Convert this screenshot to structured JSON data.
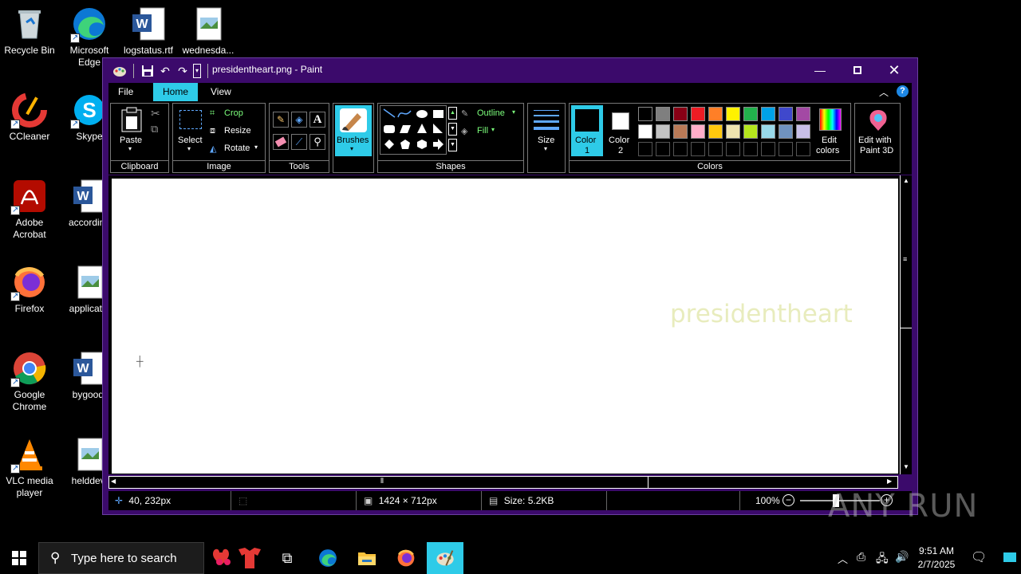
{
  "desktop": {
    "icons": [
      {
        "label": "Recycle Bin"
      },
      {
        "label": "Microsoft Edge"
      },
      {
        "label": "logstatus.rtf"
      },
      {
        "label": "wednesda..."
      },
      {
        "label": "CCleaner"
      },
      {
        "label": "Skype"
      },
      {
        "label": "Adobe Acrobat"
      },
      {
        "label": "according"
      },
      {
        "label": "Firefox"
      },
      {
        "label": "applicatio"
      },
      {
        "label": "Google Chrome"
      },
      {
        "label": "bygood."
      },
      {
        "label": "VLC media player"
      },
      {
        "label": "helddevi"
      }
    ]
  },
  "paint": {
    "title": "presidentheart.png - Paint",
    "tabs": [
      "File",
      "Home",
      "View"
    ],
    "active_tab": "Home",
    "ribbon": {
      "clipboard": {
        "label": "Clipboard",
        "paste": "Paste"
      },
      "image": {
        "label": "Image",
        "select": "Select",
        "crop": "Crop",
        "resize": "Resize",
        "rotate": "Rotate"
      },
      "tools": {
        "label": "Tools"
      },
      "brushes": {
        "label": "Brushes"
      },
      "shapes": {
        "label": "Shapes",
        "outline": "Outline",
        "fill": "Fill"
      },
      "size": {
        "label": "Size"
      },
      "colors": {
        "label": "Colors",
        "color1": "Color\n1",
        "color1_a": "Color",
        "color1_b": "1",
        "color2_a": "Color",
        "color2_b": "2",
        "edit_a": "Edit",
        "edit_b": "colors",
        "paint3d_a": "Edit with",
        "paint3d_b": "Paint 3D",
        "palette_row1": [
          "#000000",
          "#7f7f7f",
          "#880015",
          "#ed1c24",
          "#ff7f27",
          "#fff200",
          "#22b14c",
          "#00a2e8",
          "#3f48cc",
          "#a349a4"
        ],
        "palette_row2": [
          "#ffffff",
          "#c3c3c3",
          "#b97a57",
          "#ffaec9",
          "#ffc90e",
          "#efe4b0",
          "#b5e61d",
          "#99d9ea",
          "#7092be",
          "#c8bfe7"
        ]
      }
    },
    "canvas": {
      "text": "presidentheart",
      "text_color": "#e8ecbd"
    },
    "status": {
      "cursor_pos": "40, 232px",
      "dimensions": "1424 × 712px",
      "size": "Size: 5.2KB",
      "zoom": "100%"
    }
  },
  "taskbar": {
    "search_placeholder": "Type here to search",
    "time": "9:51 AM",
    "date": "2/7/2025"
  },
  "watermark": "ANY RUN",
  "colors": {
    "accent": "#2ecbe8",
    "titlebar": "#3b0a6b"
  }
}
